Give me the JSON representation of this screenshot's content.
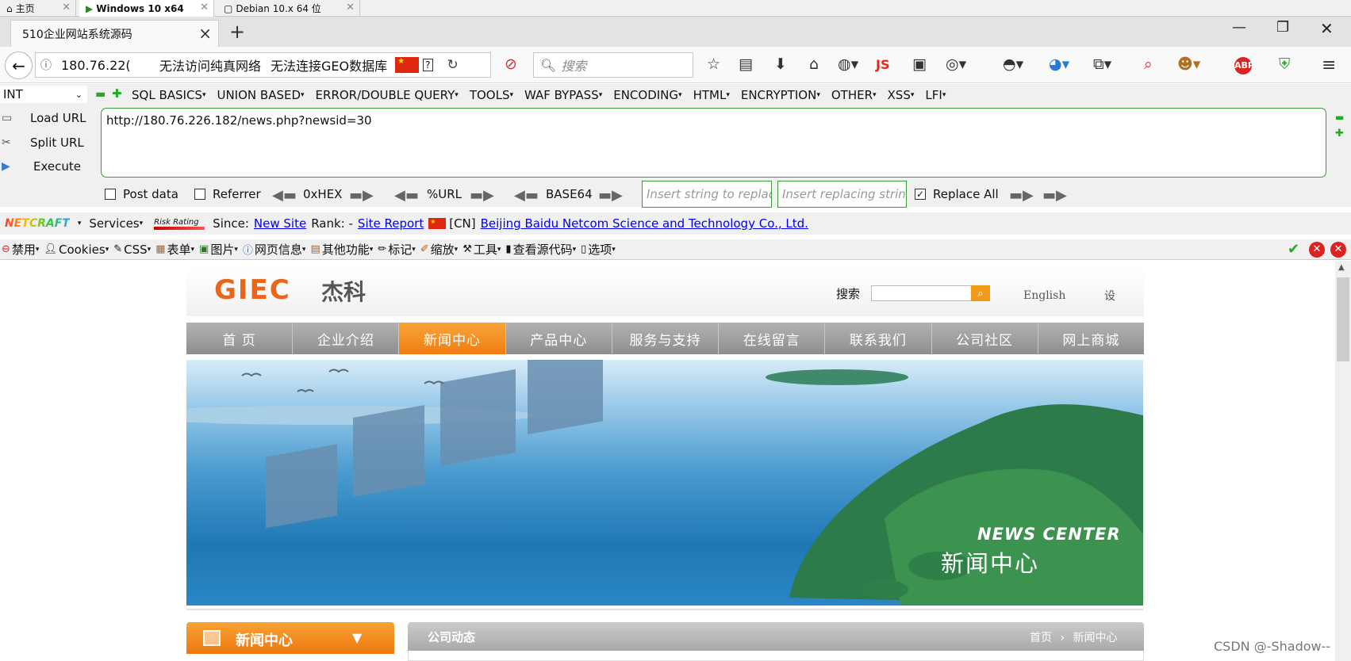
{
  "vm_tabs": [
    {
      "label": "主页"
    },
    {
      "label": "Windows 10 x64"
    },
    {
      "label": "Debian 10.x 64 位"
    }
  ],
  "browser": {
    "tab_title": "510企业网站系统源码",
    "address_text": "180.76.22(",
    "address_status1": "无法访问纯真网络",
    "address_status2": "无法连接GEO数据库",
    "search_placeholder": "搜索",
    "js_label": "JS",
    "abp_label": "ABP"
  },
  "hackbar": {
    "int_select": "INT",
    "menus": [
      "SQL BASICS",
      "UNION BASED",
      "ERROR/DOUBLE QUERY",
      "TOOLS",
      "WAF BYPASS",
      "ENCODING",
      "HTML",
      "ENCRYPTION",
      "OTHER",
      "XSS",
      "LFI"
    ],
    "load_url": "Load URL",
    "split_url": "Split URL",
    "execute": "Execute",
    "url_value": "http://180.76.226.182/news.php?newsid=30",
    "post_data": "Post data",
    "referrer": "Referrer",
    "hex": "0xHEX",
    "url_enc": "%URL",
    "base64": "BASE64",
    "insert_placeholder": "Insert string to replac",
    "replacing_placeholder": "Insert replacing string",
    "replace_all": "Replace All",
    "replace_all_checked": "✓"
  },
  "netcraft": {
    "logo": "NETCRAFT",
    "services": "Services",
    "risk": "Risk Rating",
    "since_label": "Since:",
    "since_value": "New Site",
    "rank_label": "Rank: -",
    "site_report": "Site Report",
    "country": "[CN]",
    "host": "Beijing Baidu Netcom Science and Technology Co., Ltd."
  },
  "webdev": {
    "items": [
      "禁用",
      "Cookies",
      "CSS",
      "表单",
      "图片",
      "网页信息",
      "其他功能",
      "标记",
      "缩放",
      "工具",
      "查看源代码",
      "选项"
    ]
  },
  "site": {
    "logo_en": "GIEC",
    "logo_cn": "杰科",
    "search_label": "搜索",
    "english": "English",
    "setting": "设",
    "nav": [
      "首  页",
      "企业介绍",
      "新闻中心",
      "产品中心",
      "服务与支持",
      "在线留言",
      "联系我们",
      "公司社区",
      "网上商城"
    ],
    "active_nav": 2,
    "banner_en": "NEWS CENTER",
    "banner_cn": "新闻中心",
    "left_title": "新闻中心",
    "right_title": "公司动态",
    "crumb_home": "首页",
    "crumb_sep": "›",
    "crumb_current": "新闻中心"
  },
  "watermark": "CSDN @-Shadow--",
  "colors": {
    "accent_orange": "#f07d12",
    "hackbar_green": "#3a9a3a",
    "link_blue": "#0000ee"
  }
}
